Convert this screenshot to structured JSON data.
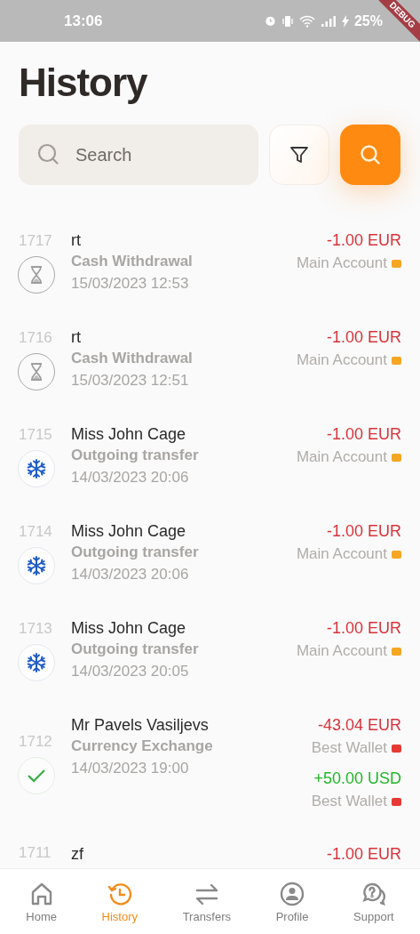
{
  "status_bar": {
    "time": "13:06",
    "battery": "25%"
  },
  "debug_banner": "DEBUG",
  "title": "History",
  "search": {
    "placeholder": "Search"
  },
  "transactions": [
    {
      "number": "1717",
      "name": "rt",
      "type": "Cash Withdrawal",
      "date": "15/03/2023 12:53",
      "kind": "pending",
      "amounts": [
        {
          "amount": "-1.00 EUR",
          "kind": "debit",
          "account": "Main Account",
          "color": "#f5a623"
        }
      ]
    },
    {
      "number": "1716",
      "name": "rt",
      "type": "Cash Withdrawal",
      "date": "15/03/2023 12:51",
      "kind": "pending",
      "amounts": [
        {
          "amount": "-1.00 EUR",
          "kind": "debit",
          "account": "Main Account",
          "color": "#f5a623"
        }
      ]
    },
    {
      "number": "1715",
      "name": "Miss John Cage",
      "type": "Outgoing transfer",
      "date": "14/03/2023 20:06",
      "kind": "frozen",
      "amounts": [
        {
          "amount": "-1.00 EUR",
          "kind": "debit",
          "account": "Main Account",
          "color": "#f5a623"
        }
      ]
    },
    {
      "number": "1714",
      "name": "Miss John Cage",
      "type": "Outgoing transfer",
      "date": "14/03/2023 20:06",
      "kind": "frozen",
      "amounts": [
        {
          "amount": "-1.00 EUR",
          "kind": "debit",
          "account": "Main Account",
          "color": "#f5a623"
        }
      ]
    },
    {
      "number": "1713",
      "name": "Miss John Cage",
      "type": "Outgoing transfer",
      "date": "14/03/2023 20:05",
      "kind": "frozen",
      "amounts": [
        {
          "amount": "-1.00 EUR",
          "kind": "debit",
          "account": "Main Account",
          "color": "#f5a623"
        }
      ]
    },
    {
      "number": "1712",
      "name": "Mr Pavels Vasiljevs",
      "type": "Currency Exchange",
      "date": "14/03/2023 19:00",
      "kind": "done",
      "amounts": [
        {
          "amount": "-43.04 EUR",
          "kind": "debit",
          "account": "Best Wallet",
          "color": "#e53935"
        },
        {
          "amount": "+50.00 USD",
          "kind": "credit",
          "account": "Best Wallet",
          "color": "#e53935"
        }
      ]
    },
    {
      "number": "1711",
      "name": "zf",
      "amounts": [
        {
          "amount": "-1.00 EUR",
          "kind": "debit"
        }
      ]
    }
  ],
  "nav": [
    {
      "kind": "home",
      "label": "Home",
      "selected": false
    },
    {
      "kind": "history",
      "label": "History",
      "selected": true
    },
    {
      "kind": "transfers",
      "label": "Transfers",
      "selected": false
    },
    {
      "kind": "profile",
      "label": "Profile",
      "selected": false
    },
    {
      "kind": "support",
      "label": "Support",
      "selected": false
    }
  ]
}
